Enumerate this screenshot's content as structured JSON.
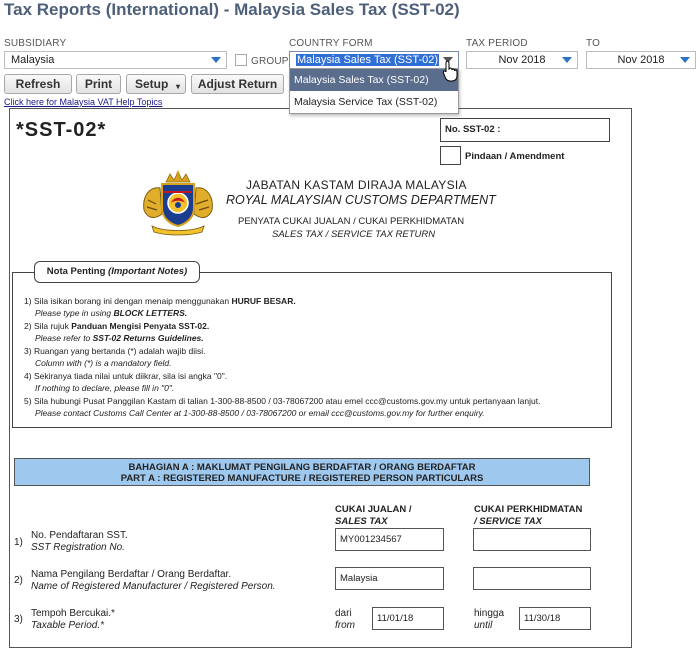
{
  "page_title": "Tax Reports (International) - Malaysia Sales Tax (SST-02)",
  "filters": {
    "subsidiary_label": "SUBSIDIARY",
    "subsidiary_value": "Malaysia",
    "group_label": "GROUP",
    "country_form_label": "COUNTRY FORM",
    "country_form_value": "Malaysia Sales Tax (SST-02)",
    "tax_period_label": "TAX PERIOD",
    "tax_period_value": "Nov 2018",
    "to_label": "TO",
    "to_value": "Nov 2018"
  },
  "dropdown_options": [
    "Malaysia Sales Tax (SST-02)",
    "Malaysia Service Tax (SST-02)"
  ],
  "toolbar": {
    "refresh": "Refresh",
    "print": "Print",
    "setup": "Setup",
    "adjust_return": "Adjust Return"
  },
  "help_link": "Click here for Malaysia VAT Help Topics",
  "form": {
    "code": "*SST-02*",
    "no_label": "No. SST-02 :",
    "amendment": "Pindaan / Amendment",
    "dept_ms": "JABATAN KASTAM DIRAJA MALAYSIA",
    "dept_en": "ROYAL MALAYSIAN CUSTOMS DEPARTMENT",
    "return_ms": "PENYATA CUKAI JUALAN / CUKAI PERKHIDMATAN",
    "return_en": "SALES TAX / SERVICE TAX RETURN",
    "notes_title_ms": "Nota Penting",
    "notes_title_en": "(Important Notes)",
    "notes": [
      {
        "n": "1)",
        "ms_a": "Sila isikan borang ini dengan menaip menggunakan ",
        "ms_b": "HURUF BESAR.",
        "en_a": "Please type in using ",
        "en_b": "BLOCK LETTERS."
      },
      {
        "n": "2)",
        "ms_a": "Sila rujuk ",
        "ms_b": "Panduan Mengisi Penyata SST-02.",
        "en_a": "Please refer to ",
        "en_b": "SST-02 Returns Guidelines."
      },
      {
        "n": "3)",
        "ms_a": "Ruangan yang bertanda (*) adalah wajib diisi.",
        "ms_b": "",
        "en_a": "Column with (*) is a mandatory field.",
        "en_b": ""
      },
      {
        "n": "4)",
        "ms_a": "Sekiranya tiada nilai untuk diikrar, sila isi angka \"0\".",
        "ms_b": "",
        "en_a": "If nothing to declare, please fill in \"0\".",
        "en_b": ""
      },
      {
        "n": "5)",
        "ms_a": "Sila hubungi Pusat Panggilan Kastam di talian 1-300-88-8500 / 03-78067200 atau emel ccc@customs.gov.my untuk pertanyaan lanjut.",
        "ms_b": "",
        "en_a": "Please contact Customs Call Center at 1-300-88-8500 / 03-78067200 or email ccc@customs.gov.my for further enquiry.",
        "en_b": ""
      }
    ],
    "part_a_ms": "BAHAGIAN A : MAKLUMAT PENGILANG BERDAFTAR / ORANG BERDAFTAR",
    "part_a_en": "PART A : REGISTERED MANUFACTURE / REGISTERED PERSON PARTICULARS",
    "col_sales_ms": "CUKAI JUALAN /",
    "col_sales_en": "SALES TAX",
    "col_service_ms": "CUKAI PERKHIDMATAN",
    "col_service_en": "/ SERVICE TAX",
    "rows": {
      "r1_num": "1)",
      "r1_ms": "No. Pendaftaran SST.",
      "r1_en": "SST Registration No.",
      "r1_sales": "MY001234567",
      "r1_service": "",
      "r2_num": "2)",
      "r2_ms": "Nama Pengilang Berdaftar / Orang Berdaftar.",
      "r2_en": "Name of Registered Manufacturer / Registered Person.",
      "r2_sales": "Malaysia",
      "r2_service": "",
      "r3_num": "3)",
      "r3_ms": "Tempoh Bercukai.*",
      "r3_en": "Taxable Period.*",
      "from_ms": "dari",
      "from_en": "from",
      "from_value": "11/01/18",
      "until_ms": "hingga",
      "until_en": "until",
      "until_value": "11/30/18"
    }
  }
}
